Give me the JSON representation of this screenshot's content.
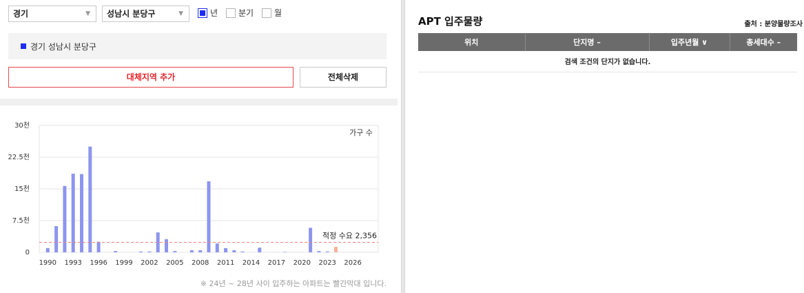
{
  "filters": {
    "province": "경기",
    "district": "성남시 분당구",
    "periods": [
      {
        "label": "년",
        "checked": true
      },
      {
        "label": "분기",
        "checked": false
      },
      {
        "label": "월",
        "checked": false
      }
    ]
  },
  "selected_region": "경기 성남시 분당구",
  "buttons": {
    "add_region": "대체지역 추가",
    "clear_all": "전체삭제"
  },
  "colors": {
    "accent_blue": "#1d2bf5",
    "bar": "#8d95ee",
    "future_bar": "#f7b29b",
    "threshold": "#f08080",
    "button_red": "#e8262c"
  },
  "chart_data": {
    "type": "bar",
    "series_label": "가구 수",
    "ylim": [
      0,
      30000
    ],
    "yticks": [
      {
        "value": 0,
        "label": "0"
      },
      {
        "value": 7500,
        "label": "7.5천"
      },
      {
        "value": 15000,
        "label": "15천"
      },
      {
        "value": 22500,
        "label": "22.5천"
      },
      {
        "value": 30000,
        "label": "30천"
      }
    ],
    "xlim": [
      1989,
      2029
    ],
    "xticks": [
      1990,
      1993,
      1996,
      1999,
      2002,
      2005,
      2008,
      2011,
      2014,
      2017,
      2020,
      2023,
      2026
    ],
    "bars": [
      {
        "year": 1990,
        "value": 1000
      },
      {
        "year": 1991,
        "value": 6200
      },
      {
        "year": 1992,
        "value": 15700
      },
      {
        "year": 1993,
        "value": 18600
      },
      {
        "year": 1994,
        "value": 18500
      },
      {
        "year": 1995,
        "value": 25000
      },
      {
        "year": 1996,
        "value": 2500
      },
      {
        "year": 1998,
        "value": 300
      },
      {
        "year": 2001,
        "value": 200
      },
      {
        "year": 2002,
        "value": 200
      },
      {
        "year": 2003,
        "value": 4700
      },
      {
        "year": 2004,
        "value": 3100
      },
      {
        "year": 2005,
        "value": 300
      },
      {
        "year": 2007,
        "value": 500
      },
      {
        "year": 2008,
        "value": 500
      },
      {
        "year": 2009,
        "value": 16800
      },
      {
        "year": 2010,
        "value": 2100
      },
      {
        "year": 2011,
        "value": 1000
      },
      {
        "year": 2012,
        "value": 500
      },
      {
        "year": 2013,
        "value": 200
      },
      {
        "year": 2015,
        "value": 1100
      },
      {
        "year": 2018,
        "value": 100
      },
      {
        "year": 2021,
        "value": 5800
      },
      {
        "year": 2022,
        "value": 300
      },
      {
        "year": 2023,
        "value": 200
      },
      {
        "year": 2024,
        "value": 1300,
        "future": true
      }
    ],
    "threshold": {
      "value": 2356,
      "label": "적정 수요 2,356"
    },
    "footnote": "※ 24년 ~ 28년 사이 입주하는 아파트는 빨간막대 입니다."
  },
  "right_panel": {
    "title": "APT 입주물량",
    "source": "출처 : 분양물량조사",
    "columns": [
      "위치",
      "단지명 –",
      "입주년월 ∨",
      "총세대수 –"
    ],
    "empty_message": "검색 조건의 단지가 없습니다."
  }
}
